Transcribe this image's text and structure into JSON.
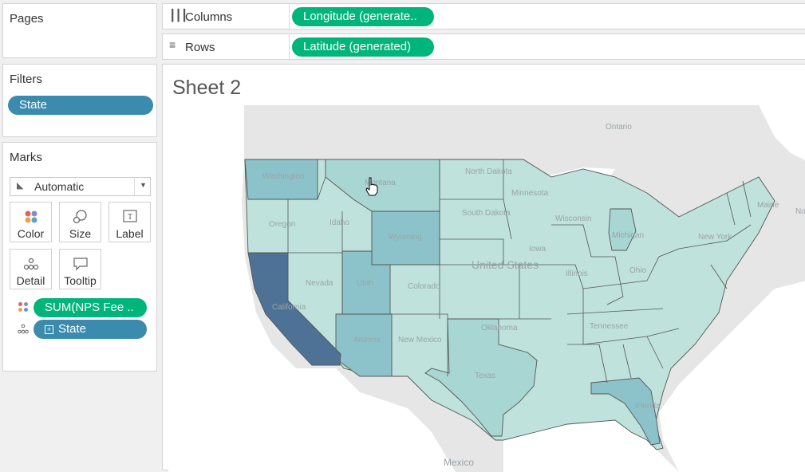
{
  "pages": {
    "title": "Pages"
  },
  "filters": {
    "title": "Filters",
    "pills": [
      "State"
    ]
  },
  "marks": {
    "title": "Marks",
    "type_dropdown": "Automatic",
    "buttons": [
      "Color",
      "Size",
      "Label",
      "Detail",
      "Tooltip"
    ],
    "fields": [
      "SUM(NPS Fee ..",
      "State"
    ]
  },
  "shelves": {
    "columns": {
      "label": "Columns",
      "pill": "Longitude (generate.."
    },
    "rows": {
      "label": "Rows",
      "pill": "Latitude (generated)"
    }
  },
  "sheet": {
    "title": "Sheet 2"
  },
  "map": {
    "labels": {
      "ontario": "Ontario",
      "washington": "Washington",
      "montana": "Montana",
      "north_dakota": "North Dakota",
      "south_dakota": "South Dakota",
      "minnesota": "Minnesota",
      "oregon": "Oregon",
      "idaho": "Idaho",
      "wyoming": "Wyoming",
      "wisconsin": "Wisconsin",
      "michigan": "Michigan",
      "new_york": "New York",
      "maine": "Maine",
      "united_states": "United States",
      "nevada": "Nevada",
      "utah": "Utah",
      "colorado": "Colorado",
      "iowa": "Iowa",
      "illinois": "Illinois",
      "ohio": "Ohio",
      "california": "California",
      "arizona": "Arizona",
      "new_mexico": "New Mexico",
      "oklahoma": "Oklahoma",
      "texas": "Texas",
      "tennessee": "Tennessee",
      "florida": "Florida",
      "mexico": "Mexico",
      "no": "No"
    },
    "colors": {
      "light": "#bfe2dc",
      "mid": "#8cc3cb",
      "dark": "#4d7296",
      "water": "#ffffff",
      "land": "#e6e6e6"
    }
  }
}
